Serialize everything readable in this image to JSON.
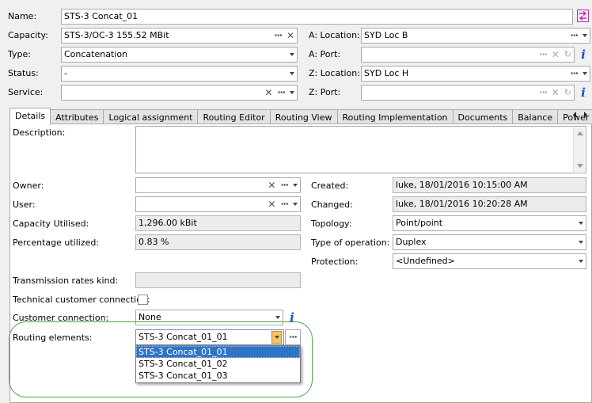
{
  "header": {
    "name": {
      "label": "Name:",
      "value": "STS-3 Concat_01"
    },
    "capacity": {
      "label": "Capacity:",
      "value": "STS-3/OC-3 155.52 MBit"
    },
    "type": {
      "label": "Type:",
      "value": "Concatenation"
    },
    "status": {
      "label": "Status:",
      "value": "-"
    },
    "service": {
      "label": "Service:",
      "value": ""
    },
    "a_location": {
      "label": "A: Location:",
      "value": "SYD Loc B"
    },
    "a_port": {
      "label": "A: Port:",
      "value": ""
    },
    "z_location": {
      "label": "Z: Location:",
      "value": "SYD Loc H"
    },
    "z_port": {
      "label": "Z: Port:",
      "value": ""
    }
  },
  "tabs": [
    {
      "label": "Details",
      "active": true
    },
    {
      "label": "Attributes"
    },
    {
      "label": "Logical assignment"
    },
    {
      "label": "Routing Editor"
    },
    {
      "label": "Routing View"
    },
    {
      "label": "Routing Implementation"
    },
    {
      "label": "Documents"
    },
    {
      "label": "Balance"
    },
    {
      "label": "Power Ma"
    }
  ],
  "details": {
    "description": {
      "label": "Description:",
      "value": ""
    },
    "owner": {
      "label": "Owner:",
      "value": ""
    },
    "user": {
      "label": "User:",
      "value": ""
    },
    "capacity_utilised": {
      "label": "Capacity Utilised:",
      "value": "1,296.00 kBit"
    },
    "percentage_utilized": {
      "label": "Percentage utilized:",
      "value": "0.83 %"
    },
    "transmission_rates_kind": {
      "label": "Transmission rates kind:",
      "value": ""
    },
    "technical_customer_connection": {
      "label": "Technical customer connection:",
      "checked": false
    },
    "customer_connection": {
      "label": "Customer connection:",
      "value": "None"
    },
    "routing_elements": {
      "label": "Routing elements:",
      "value": "STS-3 Concat_01_01",
      "options": [
        "STS-3 Concat_01_01",
        "STS-3 Concat_01_02",
        "STS-3 Concat_01_03"
      ],
      "selected_index": 0
    },
    "created": {
      "label": "Created:",
      "value": "luke, 18/01/2016 10:15:00 AM"
    },
    "changed": {
      "label": "Changed:",
      "value": "luke, 18/01/2016 10:20:28 AM"
    },
    "topology": {
      "label": "Topology:",
      "value": "Point/point"
    },
    "type_of_operation": {
      "label": "Type of operation:",
      "value": "Duplex"
    },
    "protection": {
      "label": "Protection:",
      "value": "<Undefined>"
    }
  },
  "colors": {
    "highlight_oval": "#4fa04f",
    "selection": "#3174c6",
    "info_icon": "#1a4fd6",
    "swap_icon": "#b03aa0"
  }
}
